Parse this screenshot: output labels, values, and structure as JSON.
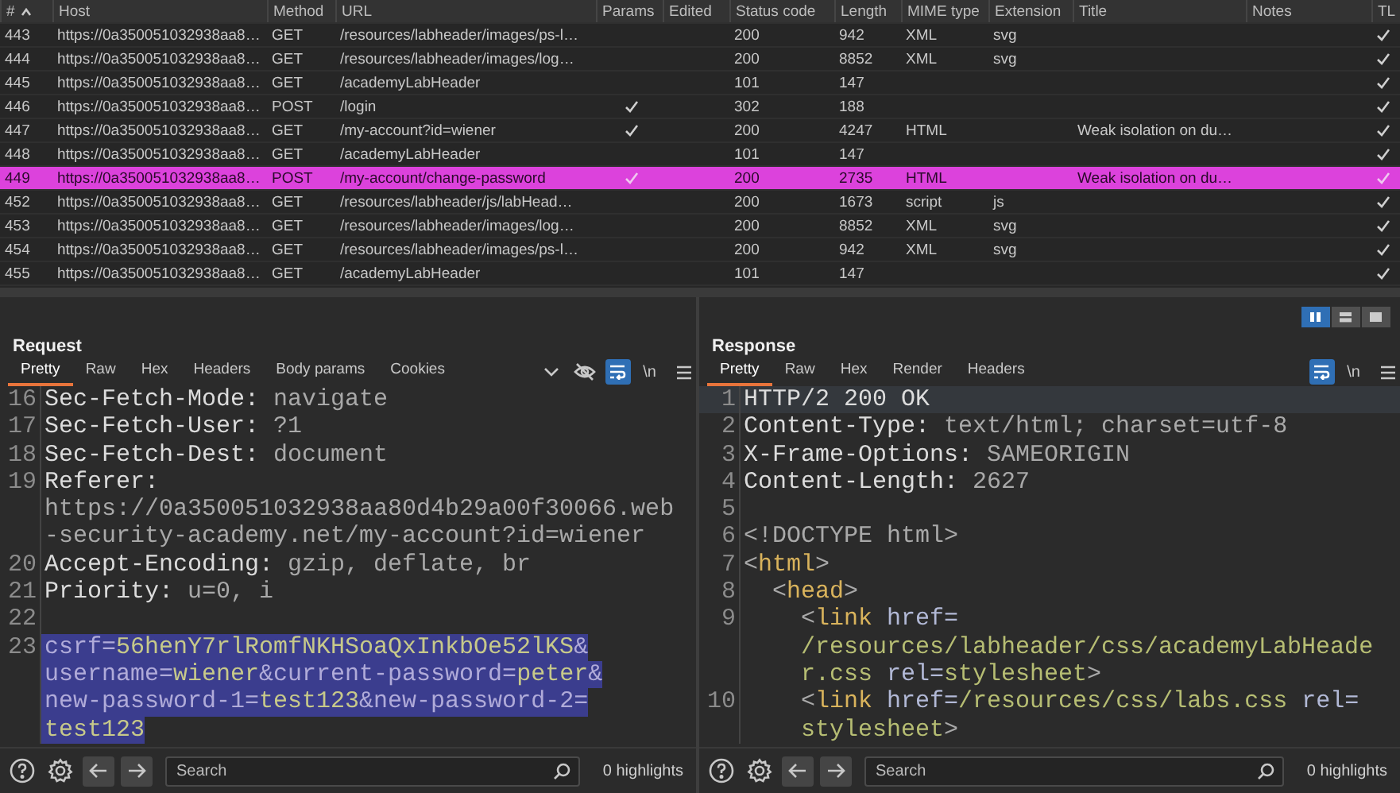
{
  "table": {
    "columns": [
      "#",
      "Host",
      "Method",
      "URL",
      "Params",
      "Edited",
      "Status code",
      "Length",
      "MIME type",
      "Extension",
      "Title",
      "Notes",
      "TL"
    ],
    "rows": [
      {
        "num": "443",
        "host": "https://0a350051032938aa8…",
        "method": "GET",
        "url": "/resources/labheader/images/ps-l…",
        "params": false,
        "status": "200",
        "length": "942",
        "mime": "XML",
        "extension": "svg",
        "tls": true
      },
      {
        "num": "444",
        "host": "https://0a350051032938aa8…",
        "method": "GET",
        "url": "/resources/labheader/images/log…",
        "params": false,
        "status": "200",
        "length": "8852",
        "mime": "XML",
        "extension": "svg",
        "tls": true
      },
      {
        "num": "445",
        "host": "https://0a350051032938aa8…",
        "method": "GET",
        "url": "/academyLabHeader",
        "params": false,
        "status": "101",
        "length": "147",
        "tls": true
      },
      {
        "num": "446",
        "host": "https://0a350051032938aa8…",
        "method": "POST",
        "url": "/login",
        "params": true,
        "status": "302",
        "length": "188",
        "tls": true
      },
      {
        "num": "447",
        "host": "https://0a350051032938aa8…",
        "method": "GET",
        "url": "/my-account?id=wiener",
        "params": true,
        "status": "200",
        "length": "4247",
        "mime": "HTML",
        "title": "Weak isolation on du…",
        "tls": true
      },
      {
        "num": "448",
        "host": "https://0a350051032938aa8…",
        "method": "GET",
        "url": "/academyLabHeader",
        "params": false,
        "status": "101",
        "length": "147",
        "tls": true
      },
      {
        "num": "449",
        "host": "https://0a350051032938aa8…",
        "method": "POST",
        "url": "/my-account/change-password",
        "params": true,
        "status": "200",
        "length": "2735",
        "mime": "HTML",
        "title": "Weak isolation on du…",
        "tls": true,
        "color": "#dc42dc"
      },
      {
        "num": "452",
        "host": "https://0a350051032938aa8…",
        "method": "GET",
        "url": "/resources/labheader/js/labHead…",
        "params": false,
        "status": "200",
        "length": "1673",
        "mime": "script",
        "extension": "js",
        "tls": true
      },
      {
        "num": "453",
        "host": "https://0a350051032938aa8…",
        "method": "GET",
        "url": "/resources/labheader/images/log…",
        "params": false,
        "status": "200",
        "length": "8852",
        "mime": "XML",
        "extension": "svg",
        "tls": true
      },
      {
        "num": "454",
        "host": "https://0a350051032938aa8…",
        "method": "GET",
        "url": "/resources/labheader/images/ps-l…",
        "params": false,
        "status": "200",
        "length": "942",
        "mime": "XML",
        "extension": "svg",
        "tls": true
      },
      {
        "num": "455",
        "host": "https://0a350051032938aa8…",
        "method": "GET",
        "url": "/academyLabHeader",
        "params": false,
        "status": "101",
        "length": "147",
        "tls": true
      }
    ]
  },
  "layout_buttons": [
    {
      "kind": "columns",
      "selected": true
    },
    {
      "kind": "rows",
      "selected": false
    },
    {
      "kind": "tabs",
      "selected": false
    }
  ],
  "panels": [
    {
      "title": "Request",
      "tabs": [
        {
          "label": "Pretty",
          "selected": true
        },
        {
          "label": "Raw",
          "selected": false
        },
        {
          "label": "Hex",
          "selected": false
        },
        {
          "label": "Headers",
          "selected": false
        },
        {
          "label": "Body params",
          "selected": false
        },
        {
          "label": "Cookies",
          "selected": false
        }
      ],
      "more_tabs": true,
      "hide_toggle": true,
      "wrap_lines": true,
      "newline_label": "\\n",
      "lines": [
        {
          "number": "16",
          "selected": false,
          "wraps": [
            {
              "segments": [
                {
                  "kind": "name",
                  "text": "Sec-Fetch-Mode:"
                },
                {
                  "kind": "value",
                  "text": " navigate"
                }
              ]
            }
          ]
        },
        {
          "number": "17",
          "selected": false,
          "wraps": [
            {
              "segments": [
                {
                  "kind": "name",
                  "text": "Sec-Fetch-User:"
                },
                {
                  "kind": "value",
                  "text": " ?1"
                }
              ]
            }
          ]
        },
        {
          "number": "18",
          "selected": false,
          "wraps": [
            {
              "segments": [
                {
                  "kind": "name",
                  "text": "Sec-Fetch-Dest:"
                },
                {
                  "kind": "value",
                  "text": " document"
                }
              ]
            }
          ]
        },
        {
          "number": "19",
          "selected": false,
          "wraps": [
            {
              "segments": [
                {
                  "kind": "name",
                  "text": "Referer:"
                }
              ]
            },
            {
              "segments": [
                {
                  "kind": "value",
                  "text": "https://0a350051032938aa80d4b29a00f30066.web"
                }
              ]
            },
            {
              "segments": [
                {
                  "kind": "value",
                  "text": "-security-academy.net/my-account?id=wiener"
                }
              ]
            }
          ]
        },
        {
          "number": "20",
          "selected": false,
          "wraps": [
            {
              "segments": [
                {
                  "kind": "name",
                  "text": "Accept-Encoding:"
                },
                {
                  "kind": "value",
                  "text": " gzip, deflate, br"
                }
              ]
            }
          ]
        },
        {
          "number": "21",
          "selected": false,
          "wraps": [
            {
              "segments": [
                {
                  "kind": "name",
                  "text": "Priority:"
                },
                {
                  "kind": "value",
                  "text": " u=0, i"
                }
              ]
            }
          ]
        },
        {
          "number": "22"
        },
        {
          "number": "23",
          "selected": true,
          "wraps": [
            {
              "segments": [
                {
                  "kind": "param",
                  "text": "csrf="
                },
                {
                  "kind": "paramval",
                  "text": "56henY7rlRomfNKHSoaQxInkbOe52lKS"
                },
                {
                  "kind": "param",
                  "text": "&"
                }
              ]
            },
            {
              "segments": [
                {
                  "kind": "param",
                  "text": "username="
                },
                {
                  "kind": "paramval",
                  "text": "wiener"
                },
                {
                  "kind": "param",
                  "text": "&current-password="
                },
                {
                  "kind": "paramval",
                  "text": "peter"
                },
                {
                  "kind": "param",
                  "text": "&"
                }
              ]
            },
            {
              "segments": [
                {
                  "kind": "param",
                  "text": "new-password-1="
                },
                {
                  "kind": "paramval",
                  "text": "test123"
                },
                {
                  "kind": "param",
                  "text": "&new-password-2="
                }
              ]
            },
            {
              "segments": [
                {
                  "kind": "paramval",
                  "text": "test123"
                }
              ]
            }
          ]
        }
      ],
      "search": {
        "placeholder": "Search"
      },
      "highlights": "0 highlights"
    },
    {
      "title": "Response",
      "tabs": [
        {
          "label": "Pretty",
          "selected": true
        },
        {
          "label": "Raw",
          "selected": false
        },
        {
          "label": "Hex",
          "selected": false
        },
        {
          "label": "Render",
          "selected": false
        },
        {
          "label": "Headers",
          "selected": false
        }
      ],
      "more_tabs": false,
      "hide_toggle": false,
      "wrap_lines": true,
      "newline_label": "\\n",
      "lines": [
        {
          "number": "1",
          "current": true,
          "wraps": [
            {
              "segments": [
                {
                  "kind": "name",
                  "text": "HTTP/2 200 OK"
                }
              ]
            }
          ]
        },
        {
          "number": "2",
          "current": false,
          "wraps": [
            {
              "segments": [
                {
                  "kind": "name",
                  "text": "Content-Type:"
                },
                {
                  "kind": "value",
                  "text": " text/html; charset=utf-8"
                }
              ]
            }
          ]
        },
        {
          "number": "3",
          "current": false,
          "wraps": [
            {
              "segments": [
                {
                  "kind": "name",
                  "text": "X-Frame-Options:"
                },
                {
                  "kind": "value",
                  "text": " SAMEORIGIN"
                }
              ]
            }
          ]
        },
        {
          "number": "4",
          "current": false,
          "wraps": [
            {
              "segments": [
                {
                  "kind": "name",
                  "text": "Content-Length:"
                },
                {
                  "kind": "value",
                  "text": " 2627"
                }
              ]
            }
          ]
        },
        {
          "number": "5",
          "current": false
        },
        {
          "number": "6",
          "current": false,
          "wraps": [
            {
              "segments": [
                {
                  "kind": "value",
                  "text": "<!DOCTYPE html>"
                }
              ]
            }
          ]
        },
        {
          "number": "7",
          "current": false,
          "wraps": [
            {
              "segments": [
                {
                  "kind": "punct",
                  "text": "<"
                },
                {
                  "kind": "tag",
                  "text": "html"
                },
                {
                  "kind": "punct",
                  "text": ">"
                }
              ]
            }
          ]
        },
        {
          "number": "8",
          "current": false,
          "wraps": [
            {
              "segments": [
                {
                  "kind": "punct",
                  "text": "  <"
                },
                {
                  "kind": "tag",
                  "text": "head"
                },
                {
                  "kind": "punct",
                  "text": ">"
                }
              ]
            }
          ]
        },
        {
          "number": "9",
          "current": false,
          "wraps": [
            {
              "segments": [
                {
                  "kind": "punct",
                  "text": "    <"
                },
                {
                  "kind": "tag",
                  "text": "link"
                },
                {
                  "kind": "attr",
                  "text": " href="
                }
              ]
            },
            {
              "segments": [
                {
                  "kind": "attrval",
                  "text": "    /resources/labheader/css/academyLabHeade"
                }
              ]
            },
            {
              "segments": [
                {
                  "kind": "attrval",
                  "text": "    r.css"
                },
                {
                  "kind": "attr",
                  "text": " rel="
                },
                {
                  "kind": "attrval",
                  "text": "stylesheet"
                },
                {
                  "kind": "punct",
                  "text": ">"
                }
              ]
            }
          ]
        },
        {
          "number": "10",
          "current": false,
          "wraps": [
            {
              "segments": [
                {
                  "kind": "punct",
                  "text": "    <"
                },
                {
                  "kind": "tag",
                  "text": "link"
                },
                {
                  "kind": "attr",
                  "text": " href="
                },
                {
                  "kind": "attrval",
                  "text": "/resources/css/labs.css"
                },
                {
                  "kind": "attr",
                  "text": " rel="
                }
              ]
            },
            {
              "segments": [
                {
                  "kind": "attrval",
                  "text": "    stylesheet"
                },
                {
                  "kind": "punct",
                  "text": ">"
                }
              ]
            }
          ]
        }
      ],
      "search": {
        "placeholder": "Search"
      },
      "highlights": "0 highlights"
    }
  ]
}
